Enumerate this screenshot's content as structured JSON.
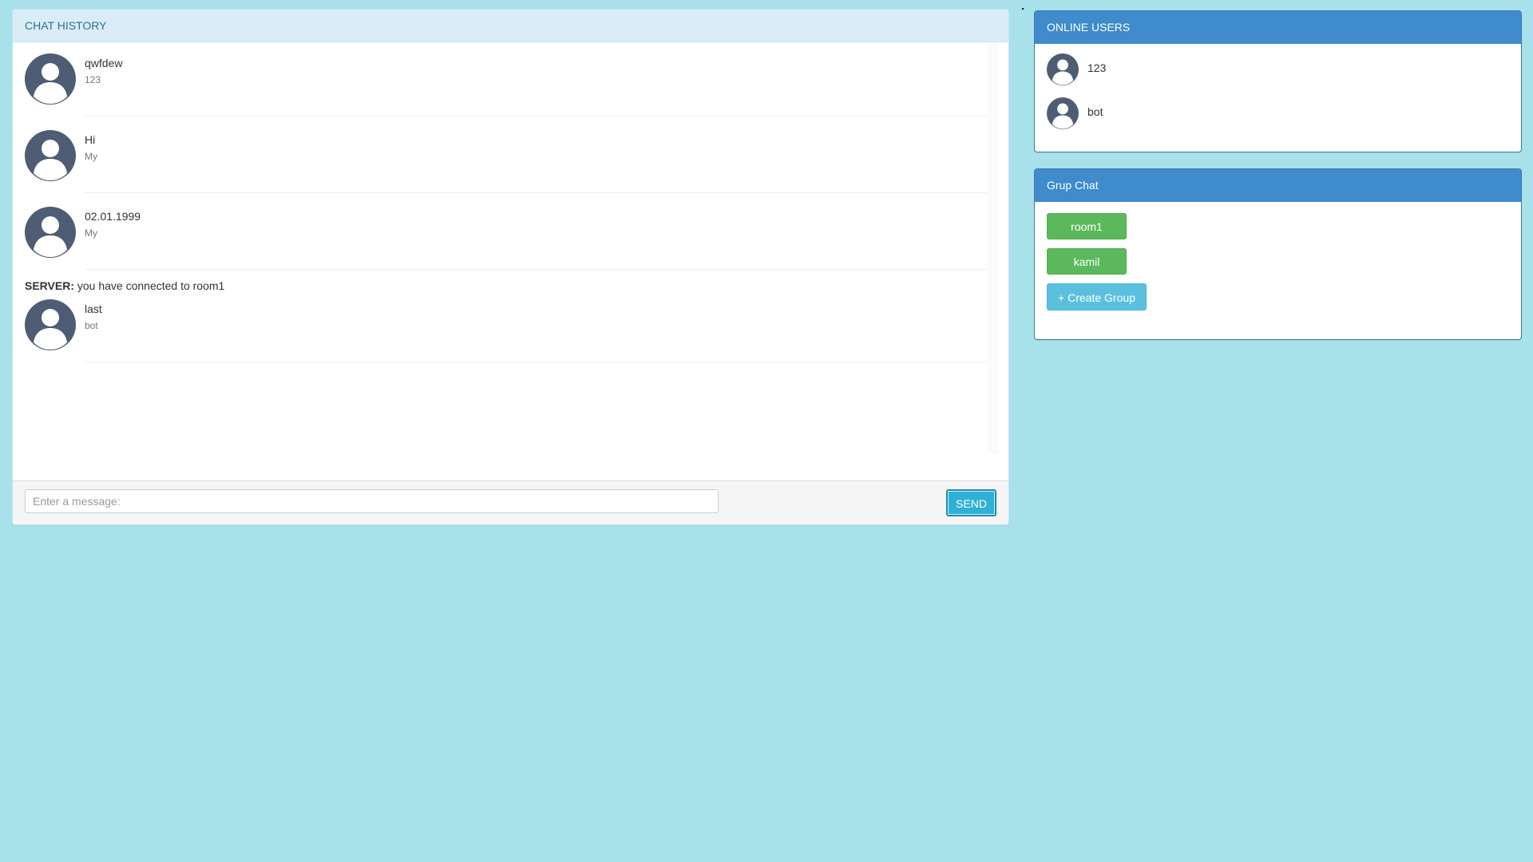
{
  "chat": {
    "heading": "CHAT HISTORY",
    "messages": [
      {
        "text": "qwfdew",
        "user": "123"
      },
      {
        "text": "Hi",
        "user": "My"
      },
      {
        "text": "02.01.1999",
        "user": "My"
      }
    ],
    "server": {
      "label": "SERVER:",
      "text": " you have connected to room1"
    },
    "last_message": {
      "text": "last",
      "user": "bot"
    },
    "input_placeholder": "Enter a message:",
    "send_label": "SEND"
  },
  "online_users": {
    "heading": "ONLINE USERS",
    "users": [
      "123",
      "bot"
    ]
  },
  "group_chat": {
    "heading": "Grup Chat",
    "groups": [
      "room1",
      "kamil"
    ],
    "create_label": "+ Create Group"
  },
  "colors": {
    "background": "#a8e1ea",
    "chat_heading_bg": "#d9edf7",
    "chat_heading_text": "#31708f",
    "side_heading_bg": "#3f8bcb",
    "group_button": "#5cb85c",
    "create_button": "#5bc0de",
    "send_button": "#31b0d5",
    "avatar": "#4e5d73"
  },
  "icons": {
    "avatar": "user-avatar-icon"
  }
}
